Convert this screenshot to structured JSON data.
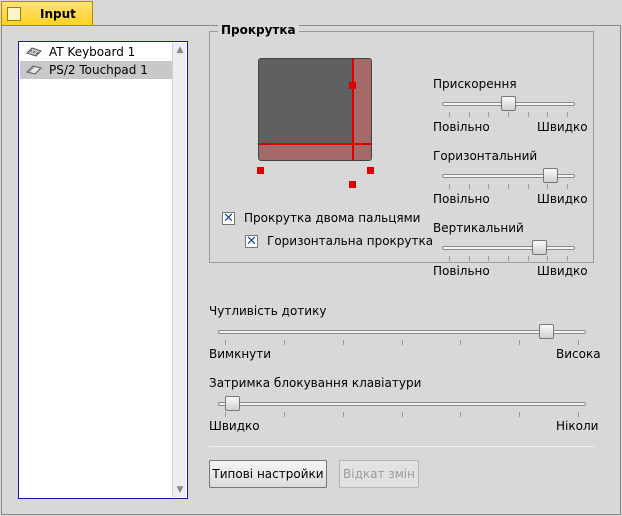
{
  "tab": {
    "title": "Input"
  },
  "devices": [
    {
      "label": "AT Keyboard 1",
      "icon": "keyboard-icon",
      "selected": false
    },
    {
      "label": "PS/2 Touchpad 1",
      "icon": "touchpad-icon",
      "selected": true
    }
  ],
  "scrolling": {
    "title": "Прокрутка",
    "two_finger_label": "Прокрутка двома пальцями",
    "two_finger_checked": true,
    "horizontal_label": "Горизонтальна прокрутка",
    "horizontal_checked": true
  },
  "acceleration": {
    "label": "Прискорення",
    "min_label": "Повільно",
    "max_label": "Швидко",
    "value": 0.5
  },
  "horizontal": {
    "label": "Горизонтальний",
    "min_label": "Повільно",
    "max_label": "Швидко",
    "value": 0.86
  },
  "vertical": {
    "label": "Вертикальний",
    "min_label": "Повільно",
    "max_label": "Швидко",
    "value": 0.76
  },
  "sensitivity": {
    "label": "Чутливість дотику",
    "min_label": "Вимкнути",
    "max_label": "Висока",
    "value": 0.91
  },
  "keyboard_lock": {
    "label": "Затримка блокування клавіатури",
    "min_label": "Швидко",
    "max_label": "Ніколи",
    "value": 0.02
  },
  "buttons": {
    "defaults": "Типові настройки",
    "revert": "Відкат змін"
  },
  "colors": {
    "tab": "#ffd11f",
    "pad": "#606060",
    "edge_zone": "#a46a6a",
    "handle": "#dd0000",
    "list_border": "#1a1a9a"
  }
}
